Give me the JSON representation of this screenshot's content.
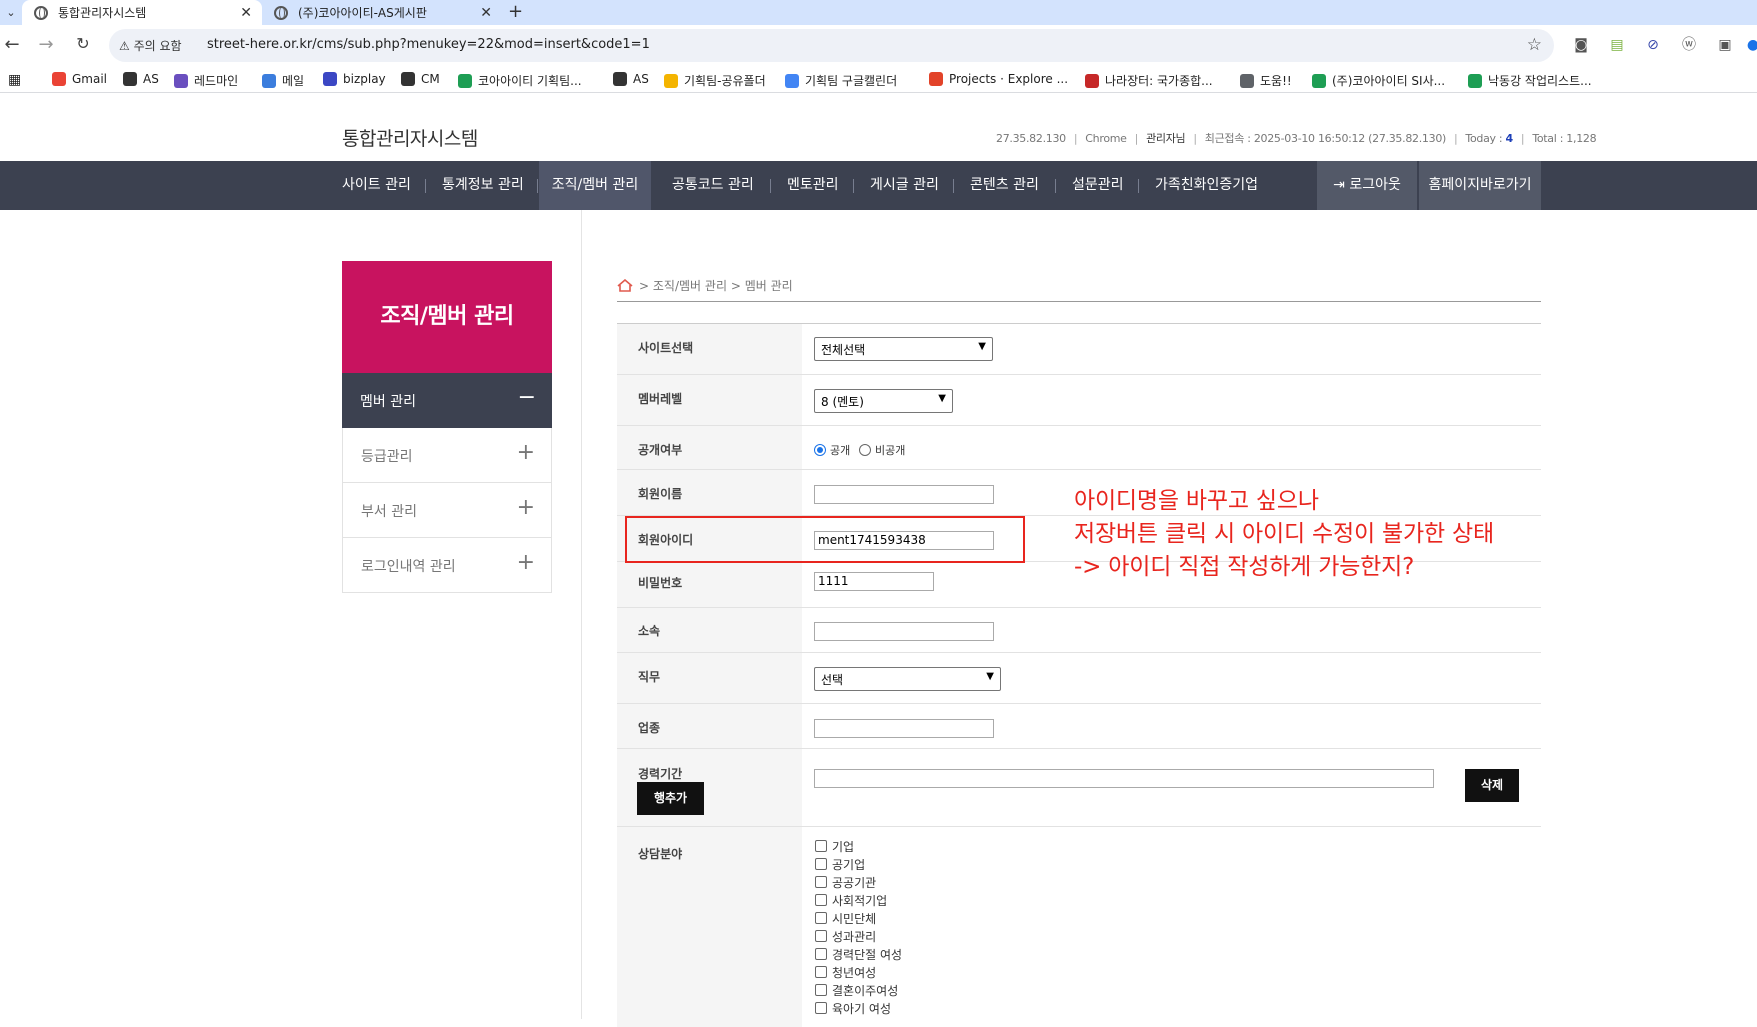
{
  "browser": {
    "tabs": [
      {
        "title": "통합관리자시스템",
        "active": true
      },
      {
        "title": "(주)코아아이티-AS게시판",
        "active": false
      }
    ],
    "close_glyph": "✕",
    "new_tab_glyph": "+",
    "security_warning": "⚠ 주의 요함",
    "url": "street-here.or.kr/cms/sub.php?menukey=22&mod=insert&code1=1",
    "bookmarks": [
      {
        "label": "Gmail",
        "color": "#ea4335"
      },
      {
        "label": "AS",
        "color": "#333333"
      },
      {
        "label": "레드마인",
        "color": "#6a4fbf"
      },
      {
        "label": "메일",
        "color": "#3b7ddd"
      },
      {
        "label": "bizplay",
        "color": "#3b47c4"
      },
      {
        "label": "CM",
        "color": "#333333"
      },
      {
        "label": "코아아이티 기획팀...",
        "color": "#1e9e54"
      },
      {
        "label": "AS",
        "color": "#333333"
      },
      {
        "label": "기획팀-공유폴더",
        "color": "#f4b400"
      },
      {
        "label": "기획팀 구글캘린더",
        "color": "#4285f4"
      },
      {
        "label": "Projects · Explore ...",
        "color": "#e24329"
      },
      {
        "label": "나라장터: 국가종합...",
        "color": "#c62828"
      },
      {
        "label": "도움!!",
        "color": "#5f6368"
      },
      {
        "label": "(주)코아아이티 SI사...",
        "color": "#1e9e54"
      },
      {
        "label": "낙동강 작업리스트...",
        "color": "#1e9e54"
      }
    ]
  },
  "header": {
    "site_title": "통합관리자시스템",
    "ip": "27.35.82.130",
    "browser_name": "Chrome",
    "user": "관리자님",
    "last_login": "최근접속 : 2025-03-10 16:50:12 (27.35.82.130)",
    "today_label": "Today : ",
    "today_value": "4",
    "total_label": "Total : 1,128"
  },
  "gnb": {
    "items": [
      "사이트 관리",
      "통계정보 관리",
      "조직/멤버 관리",
      "공통코드 관리",
      "멘토관리",
      "게시글 관리",
      "콘텐츠 관리",
      "설문관리",
      "가족친화인증기업"
    ],
    "active_index": 2,
    "logout": "로그아웃",
    "homepage": "홈페이지바로가기"
  },
  "lnb": {
    "title": "조직/멤버 관리",
    "items": [
      {
        "label": "멤버 관리",
        "active": true,
        "sign": "−"
      },
      {
        "label": "등급관리",
        "active": false,
        "sign": "+"
      },
      {
        "label": "부서 관리",
        "active": false,
        "sign": "+"
      },
      {
        "label": "로그인내역 관리",
        "active": false,
        "sign": "+"
      }
    ]
  },
  "breadcrumb": {
    "sep": ">",
    "level1": "조직/멤버 관리",
    "level2": "멤버 관리"
  },
  "form": {
    "site_select": {
      "label": "사이트선택",
      "value": "전체선택"
    },
    "member_level": {
      "label": "멤버레벨",
      "value": "8 (멘토)"
    },
    "visibility": {
      "label": "공개여부",
      "options": [
        "공개",
        "비공개"
      ],
      "selected": "공개"
    },
    "member_name": {
      "label": "회원이름",
      "value": ""
    },
    "member_id": {
      "label": "회원아이디",
      "value": "ment1741593438"
    },
    "password": {
      "label": "비밀번호",
      "value": "1111"
    },
    "affiliation": {
      "label": "소속",
      "value": ""
    },
    "job": {
      "label": "직무",
      "value": "선택"
    },
    "industry": {
      "label": "업종",
      "value": ""
    },
    "career": {
      "label": "경력기간",
      "add_row_button": "행추가",
      "delete_button": "삭제",
      "value": ""
    },
    "consult_field": {
      "label": "상담분야",
      "options": [
        "기업",
        "공기업",
        "공공기관",
        "사회적기업",
        "시민단체",
        "성과관리",
        "경력단절 여성",
        "청년여성",
        "결혼이주여성",
        "육아기 여성"
      ]
    }
  },
  "annotation": {
    "color": "#e8251e",
    "lines": [
      "아이디명을 바꾸고 싶으나",
      "저장버튼 클릭 시 아이디 수정이 불가한 상태",
      "-> 아이디 직접 작성하게 가능한지?"
    ]
  },
  "colors": {
    "lnb_head": "#c8135f",
    "gnb_bg": "#3c4150",
    "tabbar": "#d3e3fd"
  }
}
